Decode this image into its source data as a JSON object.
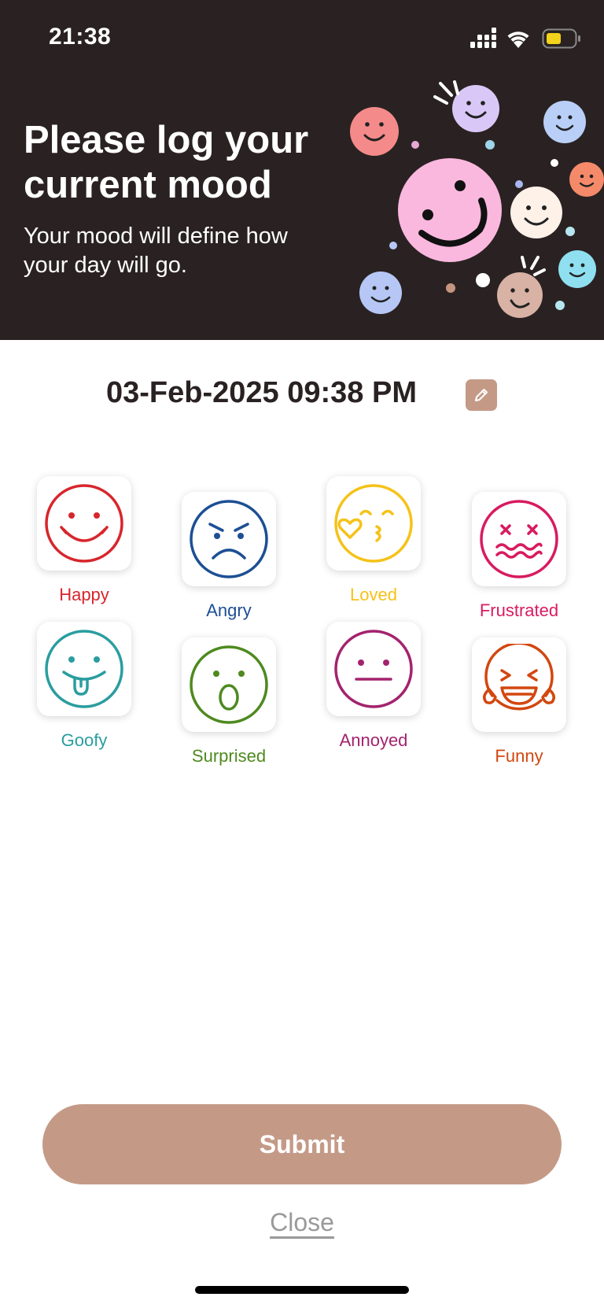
{
  "status_bar": {
    "time": "21:38"
  },
  "header": {
    "title": "Please log your current mood",
    "subtitle": "Your mood will define how your day will go."
  },
  "entry": {
    "datetime": "03-Feb-2025 09:38 PM"
  },
  "moods": [
    {
      "label": "Happy",
      "color": "#d7262d",
      "icon": "happy-face-icon"
    },
    {
      "label": "Angry",
      "color": "#1d4f94",
      "icon": "angry-face-icon"
    },
    {
      "label": "Loved",
      "color": "#f5c218",
      "icon": "kissing-face-icon"
    },
    {
      "label": "Frustrated",
      "color": "#d81b60",
      "icon": "dizzy-face-icon"
    },
    {
      "label": "Goofy",
      "color": "#2a9d9f",
      "icon": "tongue-face-icon"
    },
    {
      "label": "Surprised",
      "color": "#4e8a1f",
      "icon": "surprised-face-icon"
    },
    {
      "label": "Annoyed",
      "color": "#a3236e",
      "icon": "neutral-face-icon"
    },
    {
      "label": "Funny",
      "color": "#d2470f",
      "icon": "laughing-face-icon"
    }
  ],
  "actions": {
    "submit_label": "Submit",
    "close_label": "Close"
  },
  "colors": {
    "header_bg": "#2a2222",
    "accent": "#c49a87",
    "text_dark": "#2a2222"
  }
}
